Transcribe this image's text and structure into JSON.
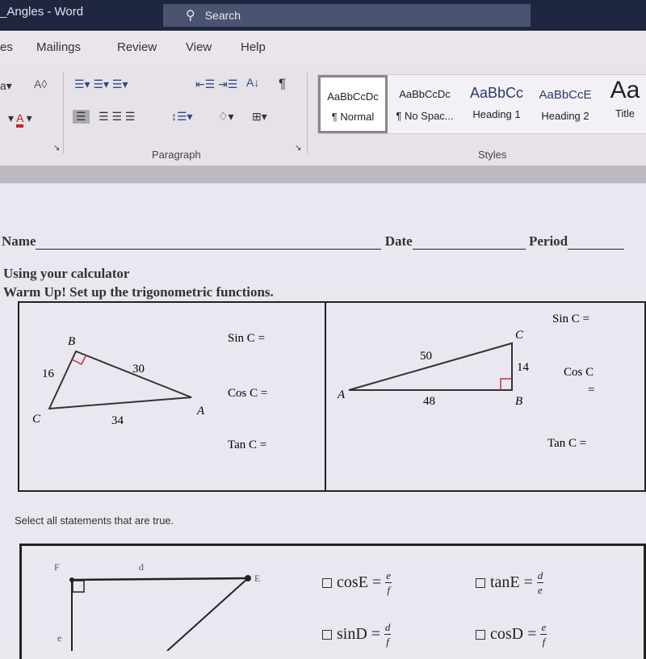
{
  "window": {
    "title": "_Angles - Word",
    "search_placeholder": "Search"
  },
  "ribbon_tabs": [
    "es",
    "Mailings",
    "Review",
    "View",
    "Help"
  ],
  "ribbon": {
    "groups": {
      "paragraph": "Paragraph",
      "styles": "Styles"
    },
    "styles": [
      {
        "preview": "AaBbCcDc",
        "name": "¶ Normal",
        "selected": true
      },
      {
        "preview": "AaBbCcDc",
        "name": "¶ No Spac..."
      },
      {
        "preview": "AaBbCc",
        "name": "Heading 1"
      },
      {
        "preview": "AaBbCcE",
        "name": "Heading 2"
      },
      {
        "preview": "Aa",
        "name": "Title"
      }
    ],
    "font_color": "#d0202a"
  },
  "document": {
    "header": {
      "name": "Name",
      "date": "Date",
      "period": "Period"
    },
    "line1": "Using your calculator",
    "line2": "Warm Up! Set up the trigonometric functions.",
    "triangle1": {
      "B": "B",
      "C": "C",
      "A": "A",
      "side_cb": "16",
      "side_ba": "30",
      "side_ca": "34",
      "sin": "Sin C =",
      "cos": "Cos C =",
      "tan": "Tan C ="
    },
    "triangle2": {
      "C": "C",
      "A": "A",
      "B": "B",
      "side_ac": "50",
      "side_cb": "14",
      "side_ab": "48",
      "sin": "Sin C =",
      "cos": "Cos C",
      "cos_eq": "=",
      "tan": "Tan C ="
    },
    "select_prompt": "Select all statements that are true.",
    "triangle3": {
      "F": "F",
      "E": "E",
      "d": "d",
      "e": "e"
    },
    "statements": [
      {
        "lhs": "cosE =",
        "num": "e",
        "den": "f"
      },
      {
        "lhs": "tanE =",
        "num": "d",
        "den": "e"
      },
      {
        "lhs": "sinD =",
        "num": "d",
        "den": "f"
      },
      {
        "lhs": "cosD =",
        "num": "e",
        "den": "f"
      }
    ]
  }
}
